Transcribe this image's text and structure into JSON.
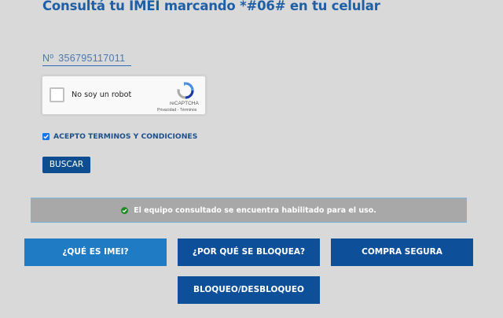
{
  "header": {
    "title": "Consultá tu IMEI marcando *#06# en tu celular"
  },
  "imei_input": {
    "prefix": "Nº",
    "value": "356795117011"
  },
  "captcha": {
    "label": "No soy un robot",
    "brand": "reCAPTCHA",
    "links": "Privacidad - Términos",
    "checked": false
  },
  "terms": {
    "label": "ACEPTO TERMINOS Y CONDICIONES",
    "checked": true
  },
  "search_button": {
    "label": "BUSCAR"
  },
  "status": {
    "message": "El equipo consultado se encuentra habilitado para el uso.",
    "icon": "check-circle-icon",
    "color": "#1f8b24"
  },
  "nav": {
    "que_es_imei": "¿QUÉ ES IMEI?",
    "por_que_se_bloquea": "¿POR QUÉ SE BLOQUEA?",
    "compra_segura": "COMPRA SEGURA",
    "bloqueo_desbloqueo": "BLOQUEO/DESBLOQUEO"
  },
  "colors": {
    "background": "#d9d9d9",
    "title": "#1f5fa6",
    "primary_dark": "#0e4f99",
    "primary_light": "#1f7bc4",
    "status_bg": "#a8a8a8"
  }
}
